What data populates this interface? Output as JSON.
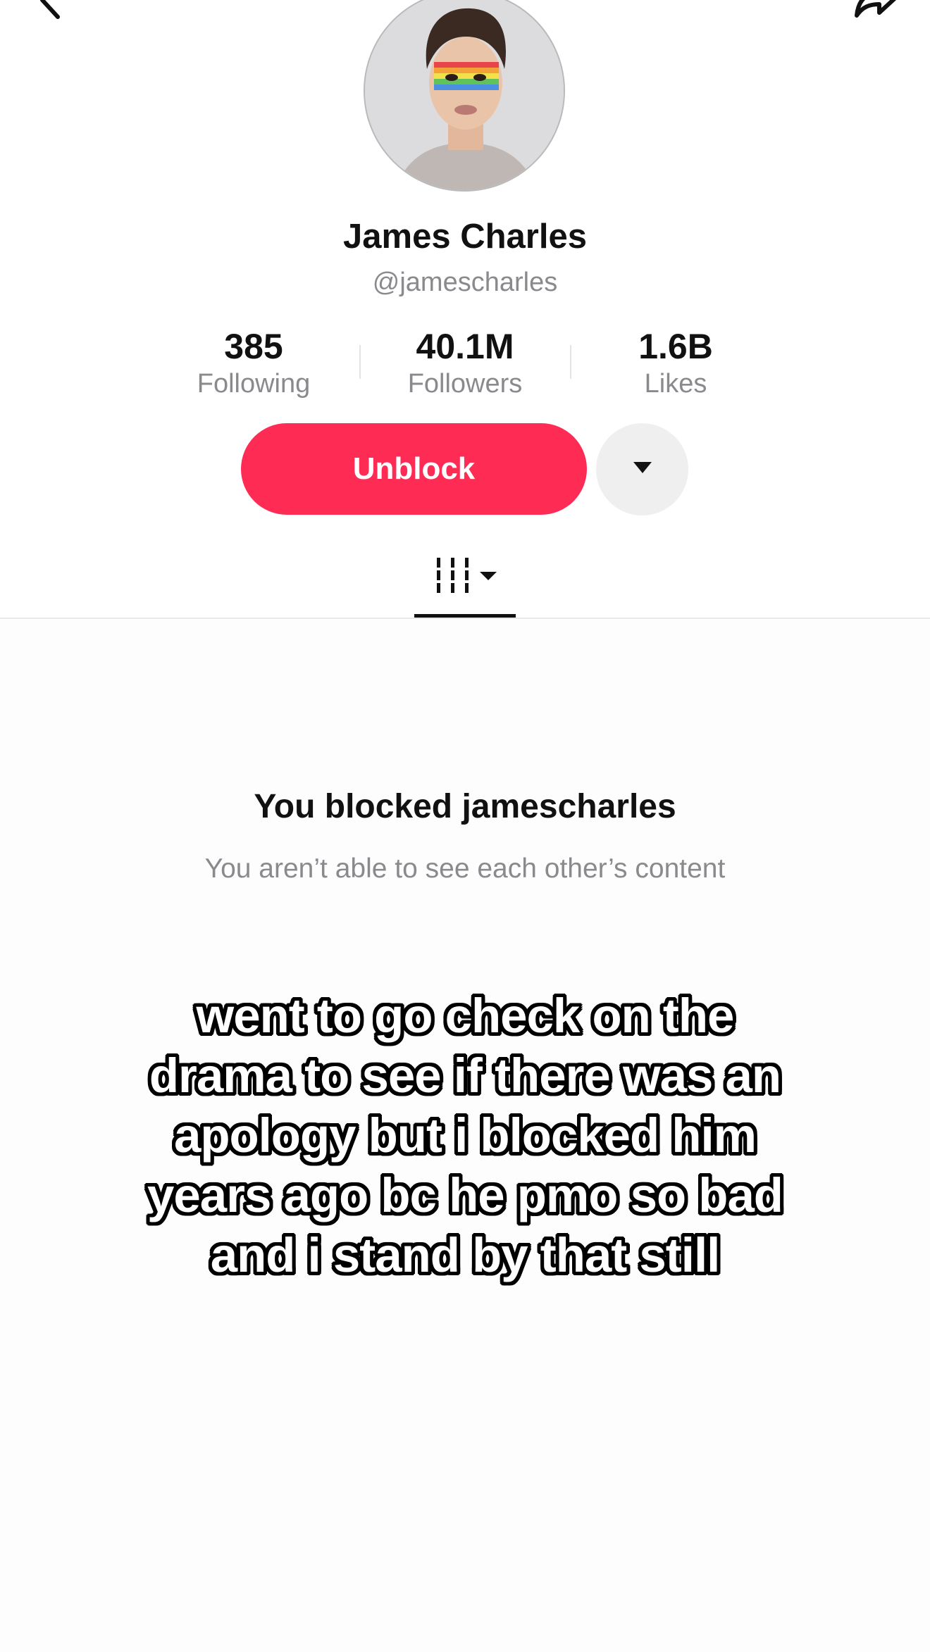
{
  "profile": {
    "display_name": "James Charles",
    "username": "@jamescharles"
  },
  "stats": [
    {
      "value": "385",
      "label": "Following"
    },
    {
      "value": "40.1M",
      "label": "Followers"
    },
    {
      "value": "1.6B",
      "label": "Likes"
    }
  ],
  "actions": {
    "unblock_label": "Unblock",
    "more_icon": "caret-down-icon"
  },
  "tabs": {
    "active_icon": "grid-icon"
  },
  "blocked_notice": {
    "title": "You blocked jamescharles",
    "subtitle": "You aren’t able to see each other’s content"
  },
  "caption": {
    "lines": [
      "went to go check on the",
      "drama to see if there was an",
      "apology but i blocked him",
      "years ago bc he pmo so bad",
      "and i stand by that still"
    ]
  },
  "colors": {
    "accent": "#fe2c55",
    "secondary_text": "#8a8a8e",
    "more_button_bg": "#efefef"
  }
}
